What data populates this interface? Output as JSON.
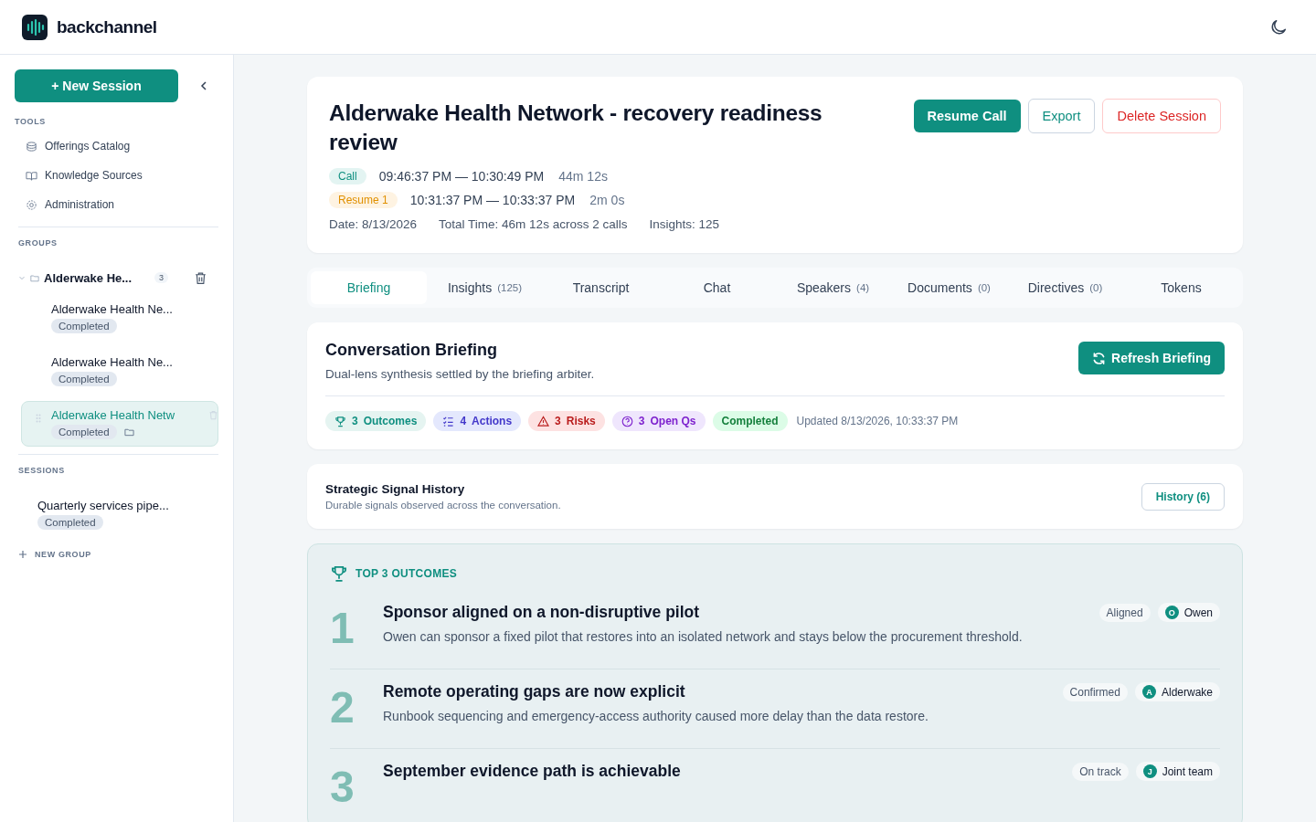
{
  "app": {
    "name": "backchannel"
  },
  "sidebar": {
    "new_session": "+ New Session",
    "tools_heading": "TOOLS",
    "tools": [
      {
        "label": "Offerings Catalog",
        "kind": "catalog"
      },
      {
        "label": "Knowledge Sources",
        "kind": "book"
      },
      {
        "label": "Administration",
        "kind": "gear"
      }
    ],
    "groups_heading": "GROUPS",
    "groups": [
      {
        "name": "Alderwake He...",
        "count": "3",
        "expanded": true,
        "children": [
          {
            "name": "Alderwake Health Ne...",
            "status": "Completed",
            "selected": false
          },
          {
            "name": "Alderwake Health Ne...",
            "status": "Completed",
            "selected": false
          },
          {
            "name": "Alderwake Health Netw",
            "status": "Completed",
            "selected": true
          }
        ]
      }
    ],
    "sessions_heading": "SESSIONS",
    "sessions": [
      {
        "name": "Quarterly services pipe...",
        "status": "Completed",
        "selected": false
      }
    ],
    "new_group": "NEW GROUP"
  },
  "session": {
    "title": "Alderwake Health Network - recovery readiness review",
    "buttons": [
      {
        "label": "Resume Call",
        "kind": "primary"
      },
      {
        "label": "Export",
        "kind": "outline"
      },
      {
        "label": "Delete Session",
        "kind": "danger"
      }
    ],
    "calls": [
      {
        "tag": "Call",
        "kind": "call",
        "range": "09:46:37 PM — 10:30:49 PM",
        "duration": "44m 12s"
      },
      {
        "tag": "Resume 1",
        "kind": "resume",
        "range": "10:31:37 PM — 10:33:37 PM",
        "duration": "2m 0s"
      }
    ],
    "meta": [
      "Date: 8/13/2026",
      "Total Time: 46m 12s across 2 calls",
      "Insights: 125"
    ]
  },
  "tabs": [
    {
      "label": "Briefing",
      "selected": true
    },
    {
      "label": "Insights",
      "count": "(125)",
      "selected": false
    },
    {
      "label": "Transcript",
      "selected": false
    },
    {
      "label": "Chat",
      "selected": false
    },
    {
      "label": "Speakers",
      "count": "(4)",
      "selected": false
    },
    {
      "label": "Documents",
      "count": "(0)",
      "selected": false
    },
    {
      "label": "Directives",
      "count": "(0)",
      "selected": false
    },
    {
      "label": "Tokens",
      "selected": false
    }
  ],
  "briefing": {
    "title": "Conversation Briefing",
    "subtitle": "Dual-lens synthesis settled by the briefing arbiter.",
    "refresh": "Refresh Briefing",
    "badges": [
      {
        "kind": "outcomes",
        "count": "3",
        "label": "Outcomes"
      },
      {
        "kind": "actions",
        "count": "4",
        "label": "Actions"
      },
      {
        "kind": "risks",
        "count": "3",
        "label": "Risks"
      },
      {
        "kind": "questions",
        "count": "3",
        "label": "Open Qs"
      },
      {
        "kind": "status",
        "label": "Completed"
      }
    ],
    "updated": "Updated 8/13/2026, 10:33:37 PM"
  },
  "signals": {
    "title": "Strategic Signal History",
    "subtitle": "Durable signals observed across the conversation.",
    "button": "History (6)"
  },
  "outcomes": {
    "heading": "TOP 3 OUTCOMES",
    "items": [
      {
        "rank": "1",
        "title": "Sponsor aligned on a non-disruptive pilot",
        "text": "Owen can sponsor a fixed pilot that restores into an isolated network and stays below the procurement threshold.",
        "status": "Aligned",
        "initial": "O",
        "owner": "Owen"
      },
      {
        "rank": "2",
        "title": "Remote operating gaps are now explicit",
        "text": "Runbook sequencing and emergency-access authority caused more delay than the data restore.",
        "status": "Confirmed",
        "initial": "A",
        "owner": "Alderwake"
      },
      {
        "rank": "3",
        "title": "September evidence path is achievable",
        "status": "On track",
        "initial": "J",
        "owner": "Joint team"
      }
    ]
  }
}
